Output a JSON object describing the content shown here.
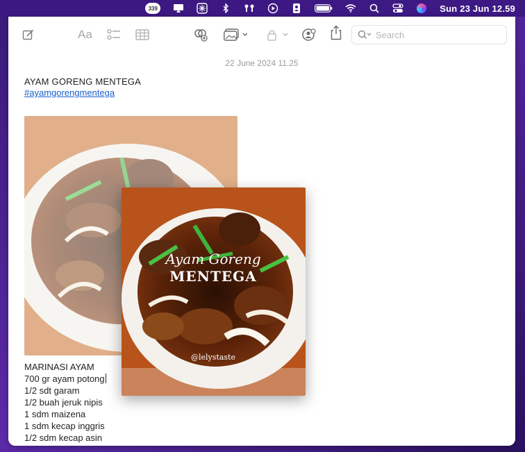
{
  "menubar": {
    "badge_count": "339",
    "clock": "Sun 23 Jun  12.59",
    "icons": [
      "storage-badge-icon",
      "airplay-icon",
      "snowflake-icon",
      "bluetooth-icon",
      "airpods-icon",
      "play-icon",
      "contact-icon",
      "battery-icon",
      "wifi-icon",
      "search-icon",
      "control-center-icon",
      "siri-icon"
    ]
  },
  "toolbar": {
    "format_label": "Aa",
    "search_placeholder": "Search",
    "icons": [
      "compose-icon",
      "format-icon",
      "checklist-icon",
      "table-icon",
      "collaborate-link-icon",
      "media-icon",
      "lock-icon",
      "share-person-icon",
      "share-icon"
    ]
  },
  "note": {
    "date": "22 June 2024 11.25",
    "title": "AYAM GORENG MENTEGA",
    "tag": "#ayamgorengmentega",
    "photo_caption_script": "Ayam Goreng",
    "photo_caption_main": "MENTEGA",
    "photo_watermark": "@lelystaste",
    "ingredients": [
      "MARINASI AYAM",
      "700 gr ayam potong",
      "1/2 sdt garam",
      "1/2 buah jeruk nipis",
      "1 sdm maizena",
      "1 sdm kecap inggris",
      "1/2 sdm kecap asin"
    ]
  },
  "colors": {
    "accent_link": "#1a5fcf",
    "desktop": "#5b2aa8"
  }
}
